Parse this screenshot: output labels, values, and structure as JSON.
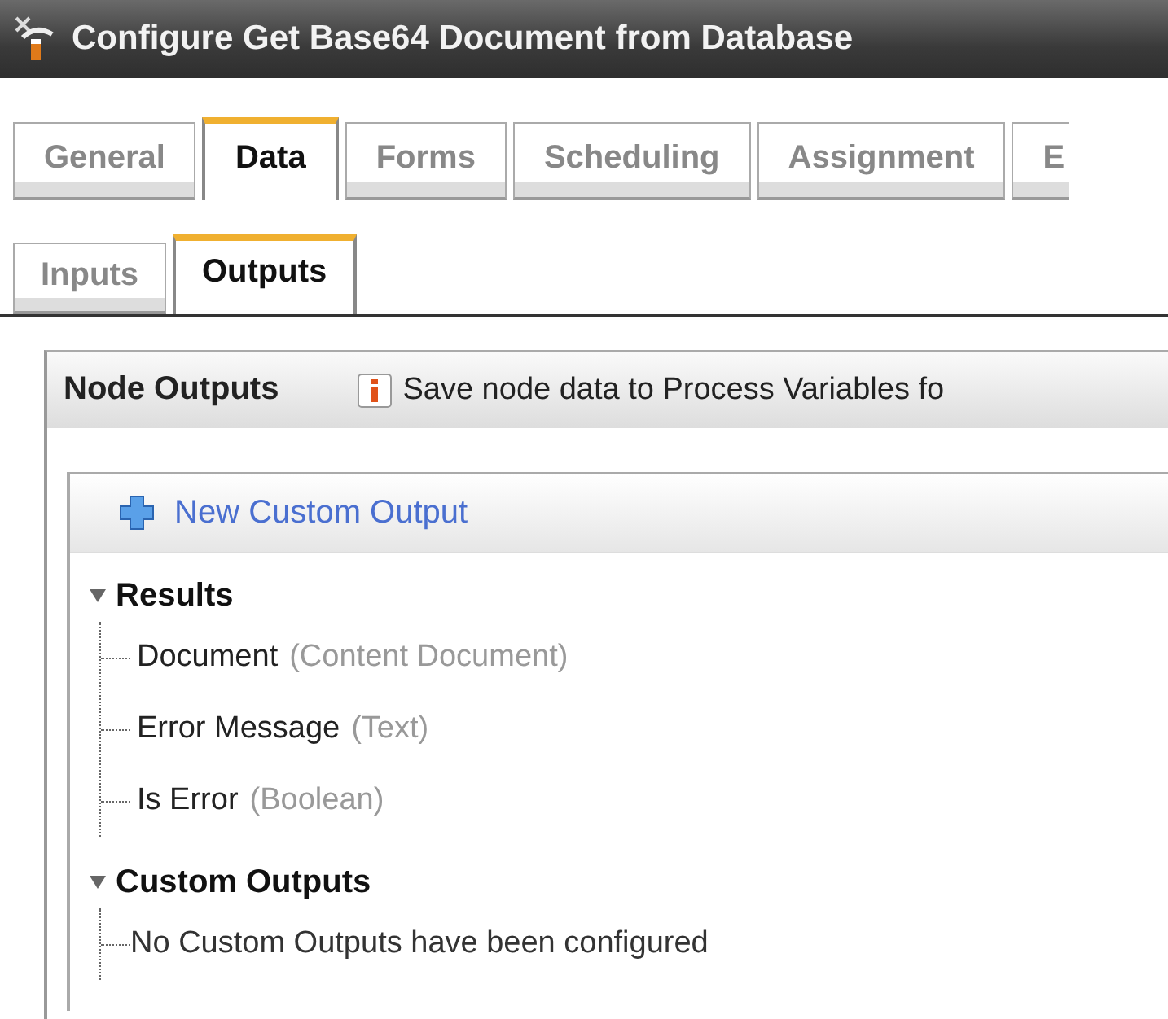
{
  "window": {
    "title": "Configure Get Base64 Document from Database"
  },
  "tabs": [
    {
      "label": "General",
      "selected": false
    },
    {
      "label": "Data",
      "selected": true
    },
    {
      "label": "Forms",
      "selected": false
    },
    {
      "label": "Scheduling",
      "selected": false
    },
    {
      "label": "Assignment",
      "selected": false
    },
    {
      "label": "E",
      "selected": false
    }
  ],
  "subtabs": [
    {
      "label": "Inputs",
      "selected": false
    },
    {
      "label": "Outputs",
      "selected": true
    }
  ],
  "panel": {
    "title": "Node Outputs",
    "info": "Save node data to Process Variables fo",
    "new_button": "New Custom Output",
    "groups": [
      {
        "label": "Results",
        "expanded": true,
        "children": [
          {
            "kind": "item",
            "name": "Document",
            "type": "(Content Document)"
          },
          {
            "kind": "item",
            "name": "Error Message",
            "type": "(Text)"
          },
          {
            "kind": "item",
            "name": "Is Error",
            "type": "(Boolean)"
          }
        ]
      },
      {
        "label": "Custom Outputs",
        "expanded": true,
        "children": [
          {
            "kind": "message",
            "text": "No Custom Outputs have been configured"
          }
        ]
      }
    ]
  }
}
